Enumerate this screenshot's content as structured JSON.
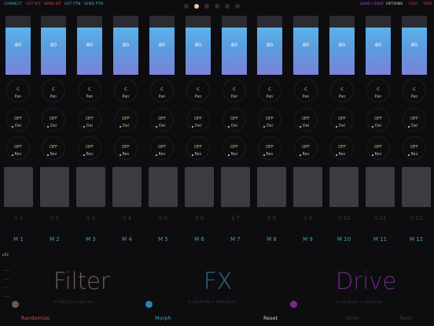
{
  "top_links": [
    {
      "label": "CONNECT",
      "color": "#3fb4c4"
    },
    {
      "label": "GET KIT",
      "color": "#d04a4a"
    },
    {
      "label": "SEND KIT",
      "color": "#d04a4a"
    },
    {
      "label": "GET PTN",
      "color": "#3fb4c4"
    },
    {
      "label": "SEND PTN",
      "color": "#3fb4c4"
    }
  ],
  "top_right": [
    {
      "label": "LOAD / SAVE",
      "color": "#b04fd0"
    },
    {
      "label": "OPTIONS",
      "color": "#cfcfcf"
    },
    {
      "label": "CALC",
      "color": "#d04a4a"
    },
    {
      "label": "TAPE",
      "color": "#d04a4a"
    }
  ],
  "page_dots_count": 6,
  "page_active_index": 1,
  "channels": [
    {
      "fader": "80",
      "pan": "C",
      "pan_label": "Pan",
      "del": "OFF",
      "del_label": "Del",
      "rev": "OFF",
      "rev_label": "Rev",
      "snapshot": "S 1",
      "morph": "M 1",
      "level": 0.8
    },
    {
      "fader": "80",
      "pan": "C",
      "pan_label": "Pan",
      "del": "OFF",
      "del_label": "Del",
      "rev": "OFF",
      "rev_label": "Rev",
      "snapshot": "S 2",
      "morph": "M 2",
      "level": 0.8
    },
    {
      "fader": "80",
      "pan": "C",
      "pan_label": "Pan",
      "del": "OFF",
      "del_label": "Del",
      "rev": "OFF",
      "rev_label": "Rev",
      "snapshot": "S 3",
      "morph": "M 3",
      "level": 0.8
    },
    {
      "fader": "80",
      "pan": "C",
      "pan_label": "Pan",
      "del": "OFF",
      "del_label": "Del",
      "rev": "OFF",
      "rev_label": "Rev",
      "snapshot": "S 4",
      "morph": "M 4",
      "level": 0.8
    },
    {
      "fader": "80",
      "pan": "C",
      "pan_label": "Pan",
      "del": "OFF",
      "del_label": "Del",
      "rev": "OFF",
      "rev_label": "Rev",
      "snapshot": "S 5",
      "morph": "M 5",
      "level": 0.8
    },
    {
      "fader": "80",
      "pan": "C",
      "pan_label": "Pan",
      "del": "OFF",
      "del_label": "Del",
      "rev": "OFF",
      "rev_label": "Rev",
      "snapshot": "S 6",
      "morph": "M 6",
      "level": 0.8
    },
    {
      "fader": "80",
      "pan": "C",
      "pan_label": "Pan",
      "del": "OFF",
      "del_label": "Del",
      "rev": "OFF",
      "rev_label": "Rev",
      "snapshot": "S 7",
      "morph": "M 7",
      "level": 0.8
    },
    {
      "fader": "80",
      "pan": "C",
      "pan_label": "Pan",
      "del": "OFF",
      "del_label": "Del",
      "rev": "OFF",
      "rev_label": "Rev",
      "snapshot": "S 8",
      "morph": "M 8",
      "level": 0.8
    },
    {
      "fader": "80",
      "pan": "C",
      "pan_label": "Pan",
      "del": "OFF",
      "del_label": "Del",
      "rev": "OFF",
      "rev_label": "Rev",
      "snapshot": "S 9",
      "morph": "M 9",
      "level": 0.8
    },
    {
      "fader": "80",
      "pan": "C",
      "pan_label": "Pan",
      "del": "OFF",
      "del_label": "Del",
      "rev": "OFF",
      "rev_label": "Rev",
      "snapshot": "S 10",
      "morph": "M 10",
      "level": 0.8
    },
    {
      "fader": "80",
      "pan": "C",
      "pan_label": "Pan",
      "del": "OFF",
      "del_label": "Del",
      "rev": "OFF",
      "rev_label": "Rev",
      "snapshot": "S 11",
      "morph": "M 11",
      "level": 0.8
    },
    {
      "fader": "80",
      "pan": "C",
      "pan_label": "Pan",
      "del": "OFF",
      "del_label": "Del",
      "rev": "OFF",
      "rev_label": "Rev",
      "snapshot": "S 12",
      "morph": "M 12",
      "level": 0.8
    }
  ],
  "colors": {
    "pan_value": "#cfcfcf",
    "del_value": "#e2b25a",
    "rev_value": "#e2b25a",
    "morph": "#3fa3a6",
    "filter": "#6e5e52",
    "fx": "#2d6a8c",
    "drive": "#6a2a7a",
    "filter_handle": "#6e5a48",
    "fx_handle": "#2b7fb4",
    "drive_handle": "#7a2a8c"
  },
  "fx_section": {
    "filter_type": "LP2",
    "filter_title": "Filter",
    "filter_sub": "X: FREQ 0%   Y: RES 0%",
    "fx_title": "FX",
    "fx_sub": "X: DELAY 0%   Y: REVERB 0%",
    "drive_title": "Drive",
    "drive_sub": "X: DRIVE 0%   Y: CRUSH 0%"
  },
  "bottom": [
    {
      "label": "Randomize",
      "color": "#d04a4a"
    },
    {
      "label": "Morph",
      "color": "#3fa3c4"
    },
    {
      "label": "Reset",
      "color": "#cfcfcf"
    },
    {
      "label": "Undo",
      "color": "#3a3a40"
    },
    {
      "label": "Redo",
      "color": "#3a3a40"
    }
  ]
}
